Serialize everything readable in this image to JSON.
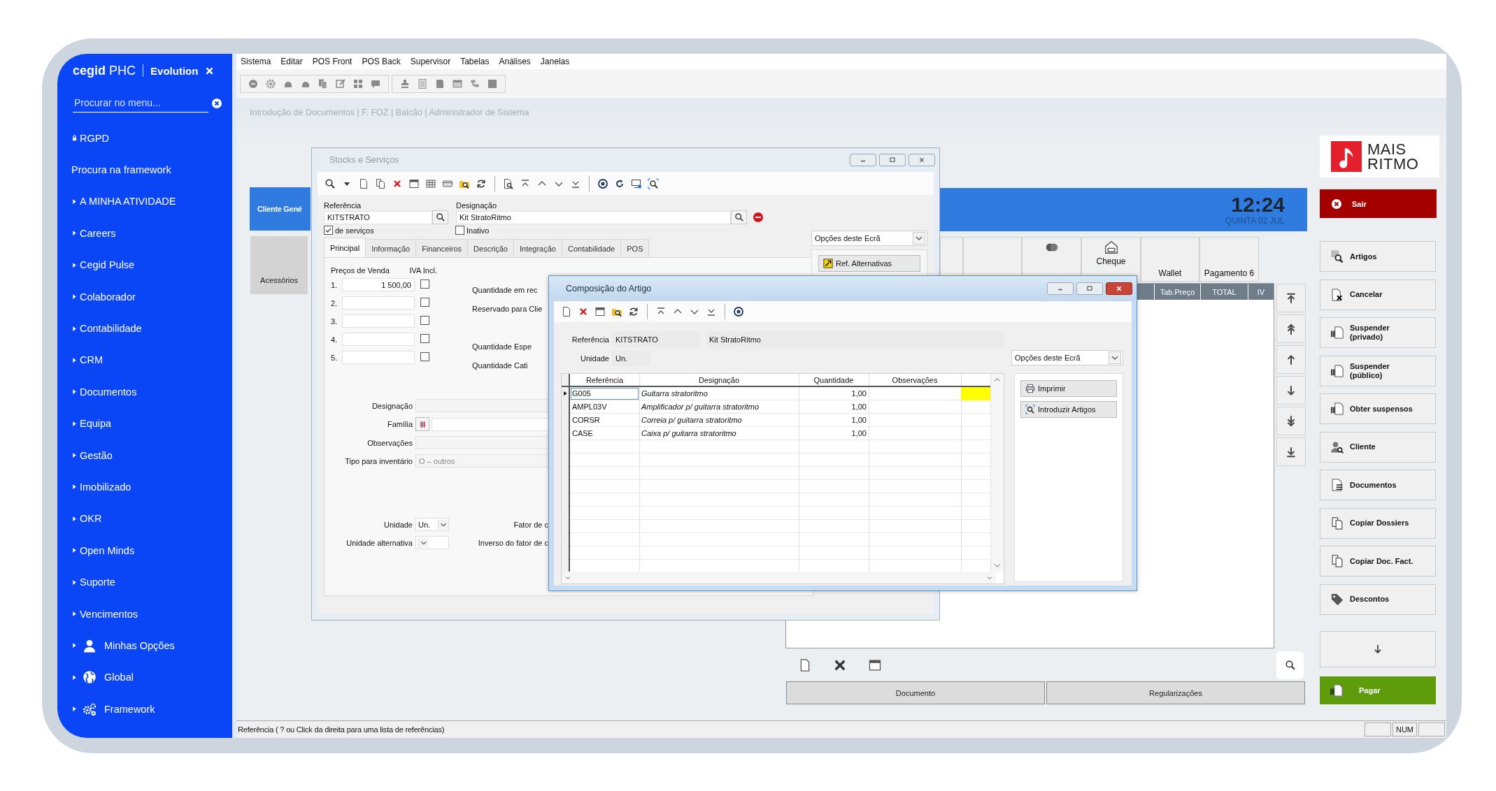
{
  "sidebar": {
    "brand": "cegid",
    "product": "PHC",
    "edition": "Evolution",
    "search": {
      "placeholder": "Procurar no menu..."
    },
    "items": [
      {
        "label": "RGPD",
        "kind": "lock"
      },
      {
        "label": "Procura na framework",
        "kind": "link"
      },
      {
        "label": "A MINHA ATIVIDADE",
        "kind": "folder"
      },
      {
        "label": "Careers",
        "kind": "folder"
      },
      {
        "label": "Cegid Pulse",
        "kind": "folder"
      },
      {
        "label": "Colaborador",
        "kind": "folder"
      },
      {
        "label": "Contabilidade",
        "kind": "folder"
      },
      {
        "label": "CRM",
        "kind": "folder"
      },
      {
        "label": "Documentos",
        "kind": "folder"
      },
      {
        "label": "Equipa",
        "kind": "folder"
      },
      {
        "label": "Gestão",
        "kind": "folder"
      },
      {
        "label": "Imobilizado",
        "kind": "folder"
      },
      {
        "label": "OKR",
        "kind": "folder"
      },
      {
        "label": "Open Minds",
        "kind": "folder"
      },
      {
        "label": "Suporte",
        "kind": "folder"
      },
      {
        "label": "Vencimentos",
        "kind": "folder"
      },
      {
        "label": "Minhas Opções",
        "kind": "user"
      },
      {
        "label": "Global",
        "kind": "globe"
      },
      {
        "label": "Framework",
        "kind": "gears"
      }
    ]
  },
  "menu_bar": [
    "Sistema",
    "Editar",
    "POS Front",
    "POS Back",
    "Supervisor",
    "Tabelas",
    "Análises",
    "Janelas"
  ],
  "document_title": "Introdução de Documentos | F. FOZ | Balcão | Administrador de Sistema",
  "pos": {
    "customer_tile": "Cliente Gené",
    "category_tile": "Acessórios",
    "logo": {
      "line_1": "MAIS",
      "line_2": "RITMO"
    },
    "clock": {
      "time": "12:24",
      "date": "QUINTA 02 JUL"
    },
    "exit_button": "Sair",
    "payment_tiles": [
      {
        "kind": "blank"
      },
      {
        "kind": "blank"
      },
      {
        "kind": "card"
      },
      {
        "label": "Cheque",
        "kind": "cheque"
      },
      {
        "label": "Wallet",
        "kind": "plain"
      },
      {
        "label": "Pagamento 6",
        "kind": "plain"
      }
    ],
    "columns": [
      "Tab.Preço",
      "TOTAL",
      "IV"
    ],
    "actions": [
      {
        "label": "Artigos",
        "kind": "search"
      },
      {
        "label": "Cancelar",
        "kind": "cancel"
      },
      {
        "label": "Suspender\n(privado)",
        "kind": "pause"
      },
      {
        "label": "Suspender\n(público)",
        "kind": "pause"
      },
      {
        "label": "Obter suspensos",
        "kind": "pause"
      },
      {
        "label": "Cliente",
        "kind": "person"
      },
      {
        "label": "Documentos",
        "kind": "document"
      },
      {
        "label": "Copiar Dossiers",
        "kind": "copy"
      },
      {
        "label": "Copiar Doc. Fact.",
        "kind": "copy"
      },
      {
        "label": "Descontos",
        "kind": "tag"
      }
    ],
    "bottom_tabs": [
      "Documento",
      "Regularizações"
    ],
    "pay_button": "Pagar"
  },
  "stocks_window": {
    "title": "Stocks e Serviços",
    "reference": {
      "label": "Referência",
      "value": "KITSTRATO"
    },
    "designation": {
      "label": "Designação",
      "value": "Kit StratoRitmo"
    },
    "services": {
      "label": "de serviços",
      "checked": true
    },
    "inactive": {
      "label": "Inativo",
      "checked": false
    },
    "screen_options": "Opções deste Ecrã",
    "alt_refs_button": "Ref. Alternativas",
    "tabs": [
      {
        "label": "Principal",
        "selected": true
      },
      {
        "label": "Informação",
        "selected": false
      },
      {
        "label": "Financeiros",
        "selected": false
      },
      {
        "label": "Descrição",
        "selected": false
      },
      {
        "label": "Integração",
        "selected": false
      },
      {
        "label": "Contabilidade",
        "selected": false
      },
      {
        "label": "POS",
        "selected": false
      }
    ],
    "prices": {
      "heading": "Preços de Venda",
      "vat_heading": "IVA Incl.",
      "rows": [
        {
          "number": "1.",
          "value": "1 500,00",
          "vat_included": false
        },
        {
          "number": "2.",
          "vat_included": false
        },
        {
          "number": "3.",
          "vat_included": false
        },
        {
          "number": "4.",
          "vat_included": false
        },
        {
          "number": "5.",
          "vat_included": false
        }
      ]
    },
    "quantity_labels": [
      "Quantidade em rec",
      "Reservado para Clie",
      "Quantidade Espe",
      "Quantidade Cati"
    ],
    "details": [
      {
        "label": "Designação",
        "kind": "text"
      },
      {
        "label": "Família",
        "kind": "family"
      },
      {
        "label": "Observações",
        "kind": "text"
      },
      {
        "label": "Tipo para inventário",
        "kind": "disabled",
        "value": "O – outros"
      }
    ],
    "units": [
      {
        "label": "Unidade",
        "value": "Un."
      },
      {
        "label": "Unidade alternativa"
      }
    ],
    "factor_labels": [
      "Fator de c",
      "Inverso do fator de c"
    ]
  },
  "composition_dialog": {
    "title": "Composição do Artigo",
    "reference": {
      "label": "Referência",
      "code": "KITSTRATO",
      "name": "Kit StratoRitmo"
    },
    "unit": {
      "label": "Unidade",
      "value": "Un."
    },
    "screen_options": "Opções deste Ecrã",
    "columns": [
      "Referência",
      "Designação",
      "Quantidade",
      "Observações"
    ],
    "rows": [
      {
        "reference": "G005",
        "designation": "Guitarra stratoritmo",
        "quantity": "1,00",
        "selected": true
      },
      {
        "reference": "AMPL03V",
        "designation": "Amplificador p/ guitarra stratoritmo",
        "quantity": "1,00",
        "selected": false
      },
      {
        "reference": "CORSR",
        "designation": "Correia p/ guitarra stratoritmo",
        "quantity": "1,00",
        "selected": false
      },
      {
        "reference": "CASE",
        "designation": "Caixa p/ guitarra stratoritmo",
        "quantity": "1,00",
        "selected": false
      }
    ],
    "buttons": [
      {
        "label": "Imprimir",
        "kind": "print"
      },
      {
        "label": "Introduzir Artigos",
        "kind": "search"
      }
    ]
  },
  "status_bar": {
    "hint": "Referência ( ? ou Click da direita para uma lista de referências)",
    "indicator": "NUM"
  }
}
